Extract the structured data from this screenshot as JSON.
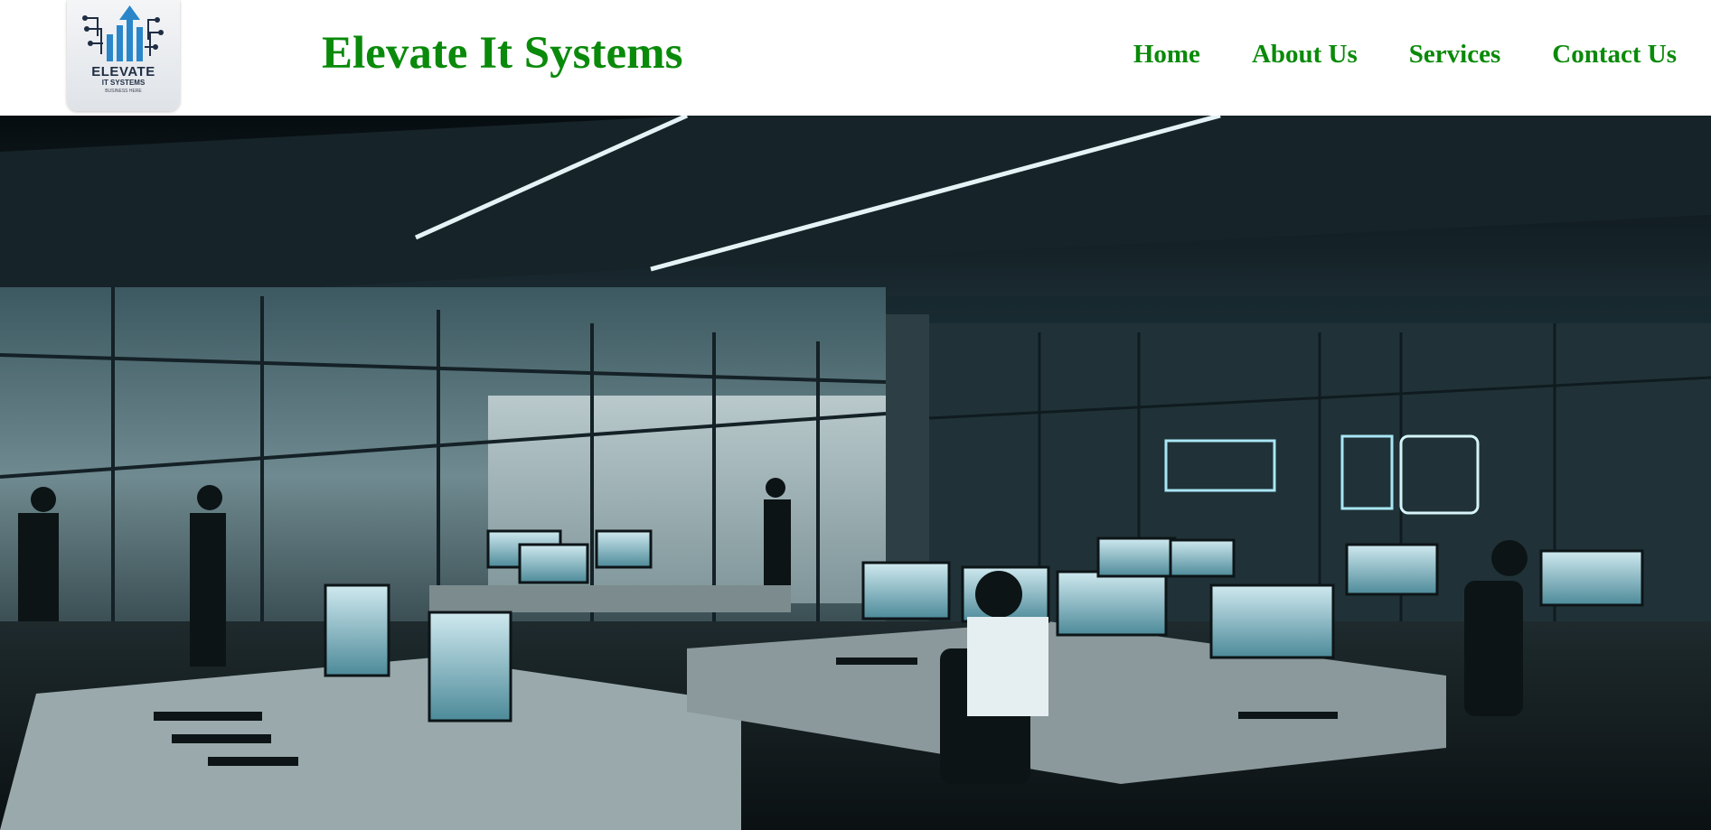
{
  "header": {
    "logo": {
      "icon": "rising-arrows-circuit-logo",
      "line1": "ELEVATE",
      "line2": "IT SYSTEMS",
      "line3": "BUSINESS HERE"
    },
    "title": "Elevate It Systems"
  },
  "nav": {
    "items": [
      {
        "label": "Home"
      },
      {
        "label": "About Us"
      },
      {
        "label": "Services"
      },
      {
        "label": "Contact Us"
      }
    ]
  },
  "colors": {
    "brand_green": "#0a8a0a",
    "hero_tone": "#2a3f45"
  },
  "hero": {
    "image": "it-operations-control-room-photo"
  }
}
